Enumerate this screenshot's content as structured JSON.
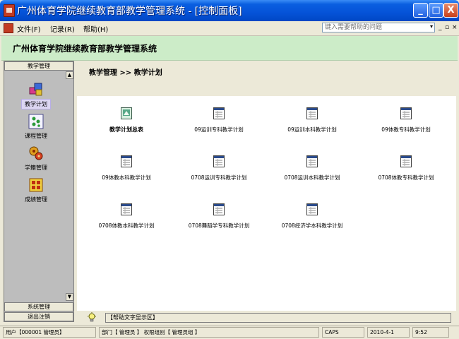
{
  "window": {
    "title": "广州体育学院继续教育部教学管理系统 - [控制面板]",
    "min_label": "_",
    "max_label": "□",
    "close_label": "X"
  },
  "menu": {
    "items": [
      "文件(F)",
      "记录(R)",
      "帮助(H)"
    ],
    "help_placeholder": "键入需要帮助的问题",
    "dropdown_glyph": "▾",
    "mini_controls": [
      "_",
      "▫",
      "×"
    ]
  },
  "header": {
    "title": "广州体育学院继续教育部教学管理系统"
  },
  "leftnav": {
    "top_group": "教学管理",
    "items": [
      {
        "label": "教学计划",
        "icon": "blocks-icon",
        "selected": true
      },
      {
        "label": "课程管理",
        "icon": "dots-icon",
        "selected": false
      },
      {
        "label": "学籍管理",
        "icon": "gears-icon",
        "selected": false
      },
      {
        "label": "成绩管理",
        "icon": "chart-icon",
        "selected": false
      }
    ],
    "bottom_groups": [
      "系统管理",
      "退出注销"
    ],
    "scroll_up": "▲",
    "scroll_down": "▼"
  },
  "main": {
    "breadcrumb": "教学管理 >> 教学计划",
    "items": [
      {
        "label": "教学计划总表",
        "icon": "summary-icon"
      },
      {
        "label": "09运训专科教学计划",
        "icon": "document-icon"
      },
      {
        "label": "09运训本科教学计划",
        "icon": "document-icon"
      },
      {
        "label": "09体教专科教学计划",
        "icon": "document-icon"
      },
      {
        "label": "09体教本科教学计划",
        "icon": "document-icon"
      },
      {
        "label": "0708运训专科教学计划",
        "icon": "document-icon"
      },
      {
        "label": "0708运训本科教学计划",
        "icon": "document-icon"
      },
      {
        "label": "0708体教专科教学计划",
        "icon": "document-icon"
      },
      {
        "label": "0708体教本科教学计划",
        "icon": "document-icon"
      },
      {
        "label": "0708舞蹈学专科教学计划",
        "icon": "document-icon"
      },
      {
        "label": "0708经济学本科教学计划",
        "icon": "document-icon"
      }
    ]
  },
  "help_area": {
    "text": "【帮助文字显示区】"
  },
  "status": {
    "user": "用户【000001 管理员】",
    "dept": "部门【 管理员 】 权限组别【 管理员组 】",
    "caps": "CAPS",
    "date": "2010-4-1",
    "time": "9:52"
  }
}
